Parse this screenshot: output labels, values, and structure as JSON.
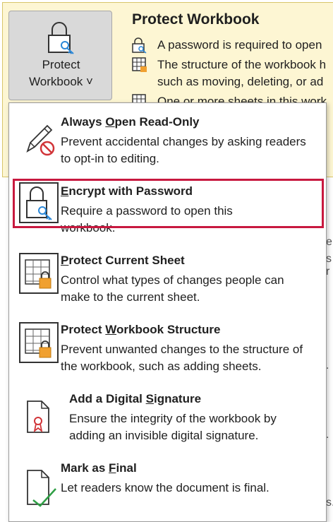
{
  "protect_button": {
    "label_line1": "Protect",
    "label_line2": "Workbook ˅"
  },
  "info_panel": {
    "title": "Protect Workbook",
    "lines": [
      "A password is required to open",
      "The structure of the workbook h",
      "such as moving, deleting, or ad",
      "One or more sheets in this work"
    ]
  },
  "background_fragments": [
    "e",
    "s r",
    ".",
    ".",
    "s."
  ],
  "menu": {
    "items": [
      {
        "title_pre": "Always ",
        "title_key": "O",
        "title_post": "pen Read-Only",
        "description": "Prevent accidental changes by asking readers to opt-in to editing."
      },
      {
        "title_pre": "",
        "title_key": "E",
        "title_post": "ncrypt with Password",
        "description": "Require a password to open this workbook."
      },
      {
        "title_pre": "",
        "title_key": "P",
        "title_post": "rotect Current Sheet",
        "description": "Control what types of changes people can make to the current sheet."
      },
      {
        "title_pre": "Protect ",
        "title_key": "W",
        "title_post": "orkbook Structure",
        "description": "Prevent unwanted changes to the structure of the workbook, such as adding sheets."
      },
      {
        "title_pre": "Add a Digital ",
        "title_key": "S",
        "title_post": "ignature",
        "description": "Ensure the integrity of the workbook by adding an invisible digital signature."
      },
      {
        "title_pre": "Mark as ",
        "title_key": "F",
        "title_post": "inal",
        "description": "Let readers know the document is final."
      }
    ]
  },
  "colors": {
    "highlight": "#c8193f",
    "lock_accent": "#f0a030",
    "key_accent": "#2b88d8",
    "no_sign": "#d13438",
    "check": "#2e9e44",
    "ribbon": "#d13438"
  }
}
